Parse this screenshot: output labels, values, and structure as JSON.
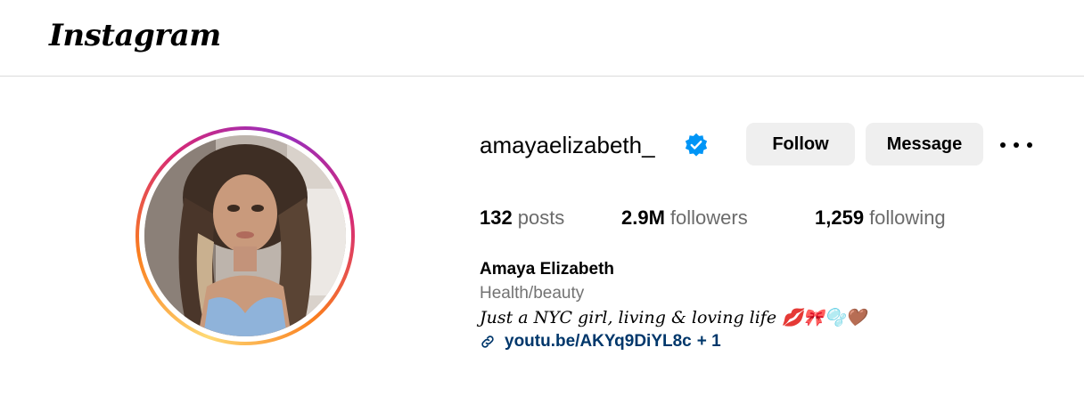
{
  "header": {
    "logo_text": "Instagram"
  },
  "profile": {
    "username": "amayaelizabeth_",
    "verified": true,
    "follow_label": "Follow",
    "message_label": "Message",
    "stats": {
      "posts_count": "132",
      "posts_label": "posts",
      "followers_count": "2.9M",
      "followers_label": "followers",
      "following_count": "1,259",
      "following_label": "following"
    },
    "full_name": "Amaya Elizabeth",
    "category": "Health/beauty",
    "bio": "Just a NYC girl, living & loving life 💋🎀🫧🤎",
    "link_text": "youtu.be/AKYq9DiYL8c",
    "link_extra": "+ 1"
  },
  "colors": {
    "verified_blue": "#0095f6",
    "button_bg": "#efefef",
    "link": "#00376b",
    "secondary_text": "#737373"
  },
  "icons": [
    "verified-badge-icon",
    "more-options-icon",
    "link-icon"
  ]
}
